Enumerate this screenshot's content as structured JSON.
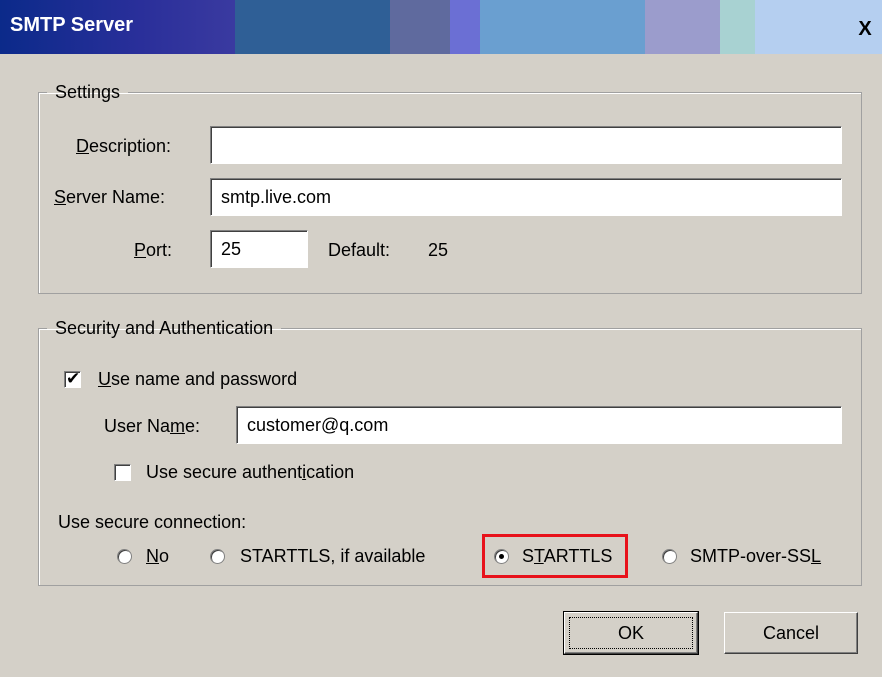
{
  "window": {
    "title": "SMTP Server",
    "close_label": "X"
  },
  "settings": {
    "legend": "Settings",
    "description": {
      "label_pre": "",
      "label_key": "D",
      "label_post": "escription:",
      "value": ""
    },
    "server_name": {
      "label_pre": "",
      "label_key": "S",
      "label_post": "erver Name:",
      "value": "smtp.live.com"
    },
    "port": {
      "label_pre": "",
      "label_key": "P",
      "label_post": "ort:",
      "value": "25"
    },
    "default_label": "Default:",
    "default_value": "25"
  },
  "security": {
    "legend": "Security and Authentication",
    "use_name_password": {
      "label_pre": "",
      "label_key": "U",
      "label_post": "se name and password",
      "checked": true
    },
    "user_name": {
      "label_pre": "User Na",
      "label_key": "m",
      "label_post": "e:",
      "value": "customer@q.com"
    },
    "secure_auth": {
      "label_pre": "Use secure authent",
      "label_key": "i",
      "label_post": "cation",
      "checked": false
    },
    "connection_label": "Use secure connection:",
    "options": [
      {
        "pre": "",
        "key": "N",
        "post": "o",
        "selected": false
      },
      {
        "pre": "STARTTLS, if available",
        "key": "",
        "post": "",
        "selected": false
      },
      {
        "pre": "S",
        "key": "T",
        "post": "ARTTLS",
        "selected": true
      },
      {
        "pre": "SMTP-over-SS",
        "key": "L",
        "post": "",
        "selected": false
      }
    ]
  },
  "buttons": {
    "ok": "OK",
    "cancel": "Cancel"
  },
  "colors": {
    "dialog_bg": "#d4d0c8",
    "highlight": "#e8121b"
  }
}
